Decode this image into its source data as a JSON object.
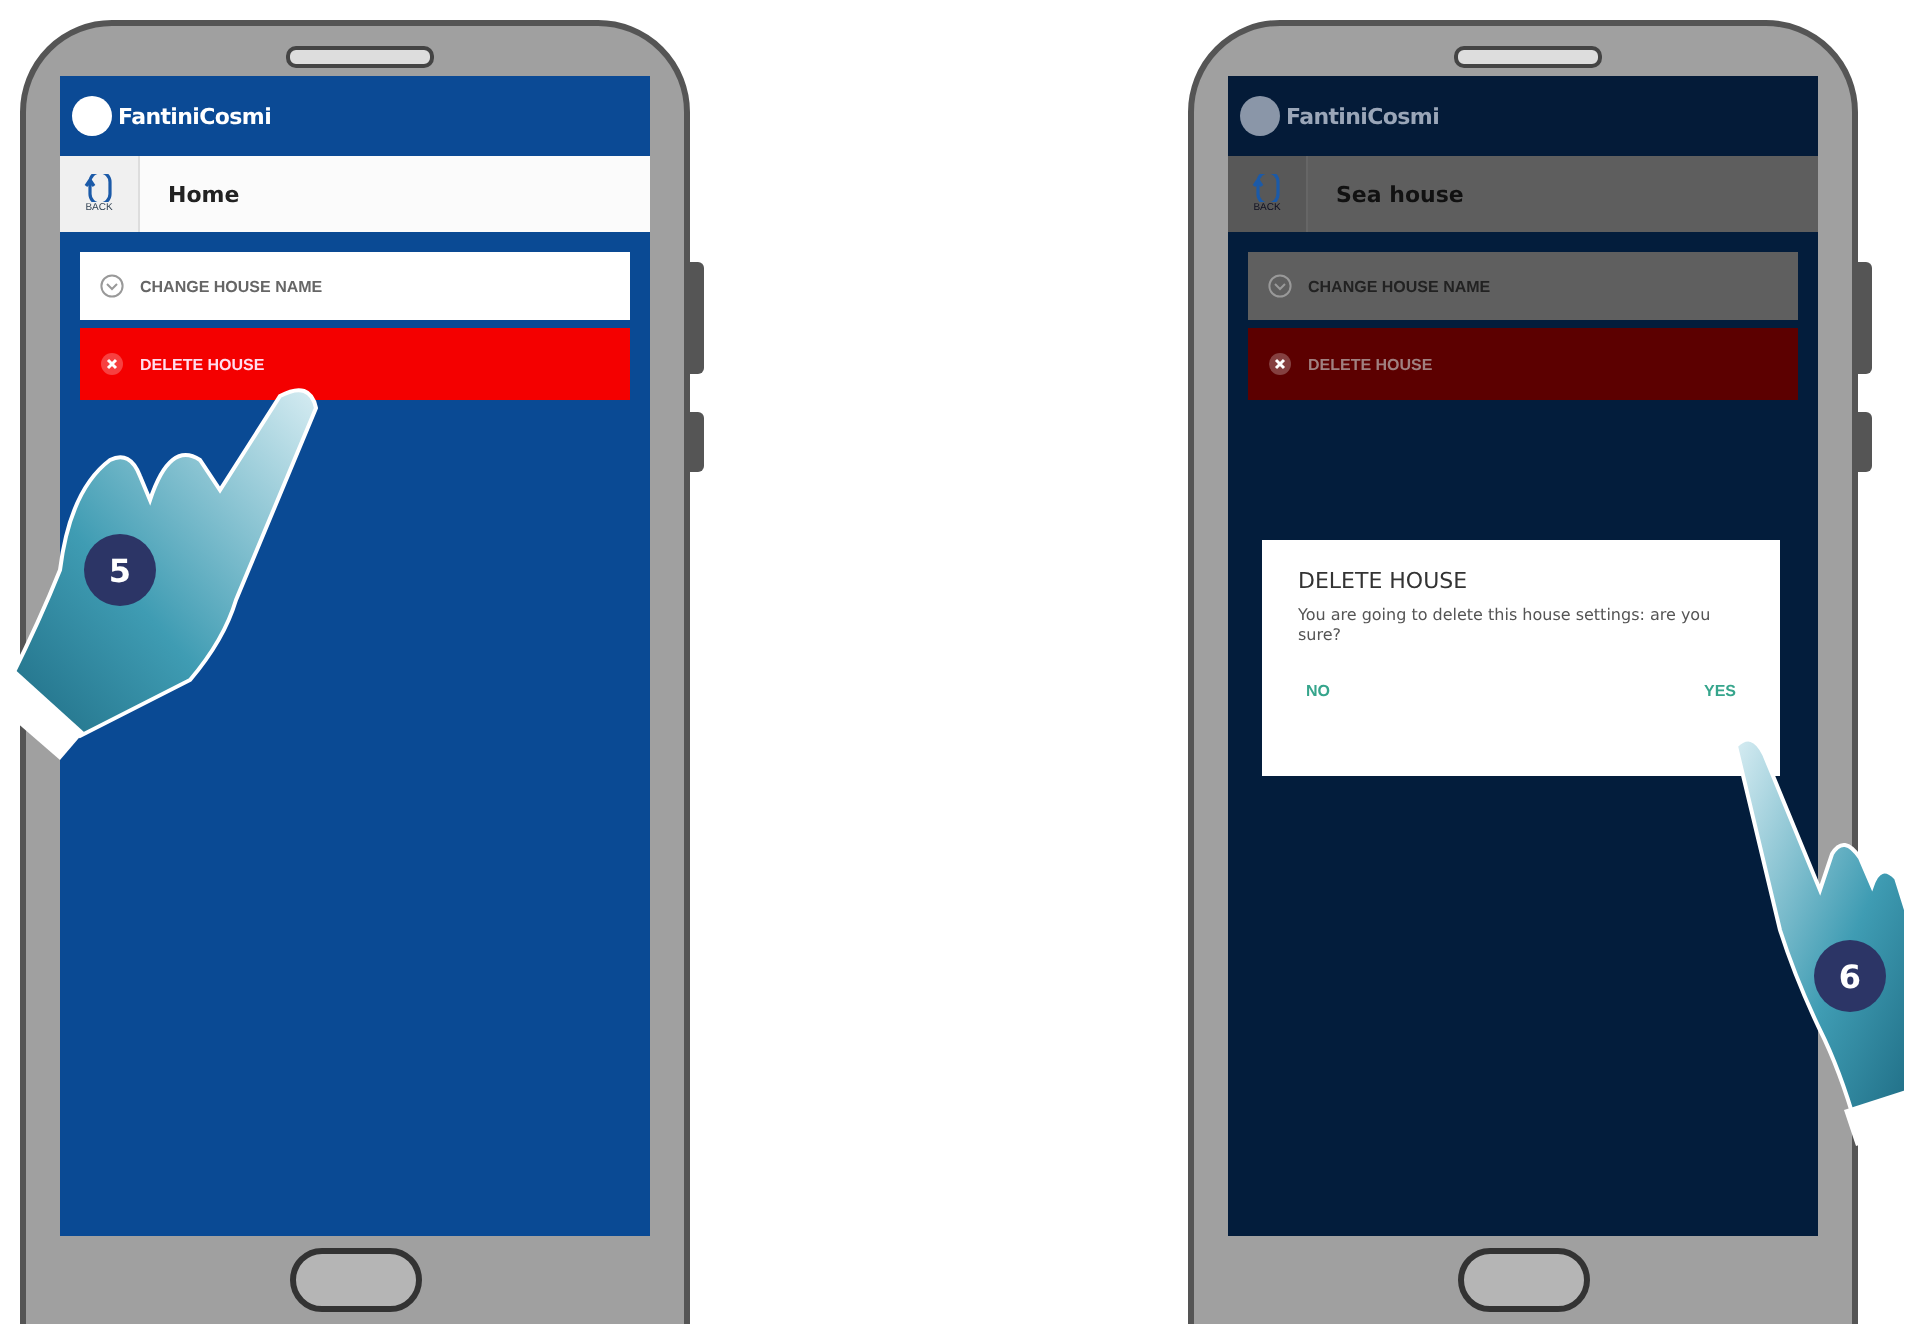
{
  "phones": [
    {
      "logo": "FantiniCosmi",
      "back_label": "BACK",
      "title": "Home",
      "menu": [
        {
          "label": "CHANGE HOUSE NAME",
          "kind": "neutral"
        },
        {
          "label": "DELETE HOUSE",
          "kind": "danger"
        }
      ],
      "dimmed": false,
      "step": "5",
      "kind": "hand-left"
    },
    {
      "logo": "FantiniCosmi",
      "back_label": "BACK",
      "title": "Sea house",
      "menu": [
        {
          "label": "CHANGE HOUSE NAME",
          "kind": "neutral"
        },
        {
          "label": "DELETE HOUSE",
          "kind": "danger"
        }
      ],
      "dimmed": true,
      "dialog": {
        "title": "DELETE HOUSE",
        "message": "You are going to delete this house settings: are you sure?",
        "buttons": [
          "NO",
          "YES"
        ]
      },
      "step": "6",
      "kind": "hand-right"
    }
  ]
}
